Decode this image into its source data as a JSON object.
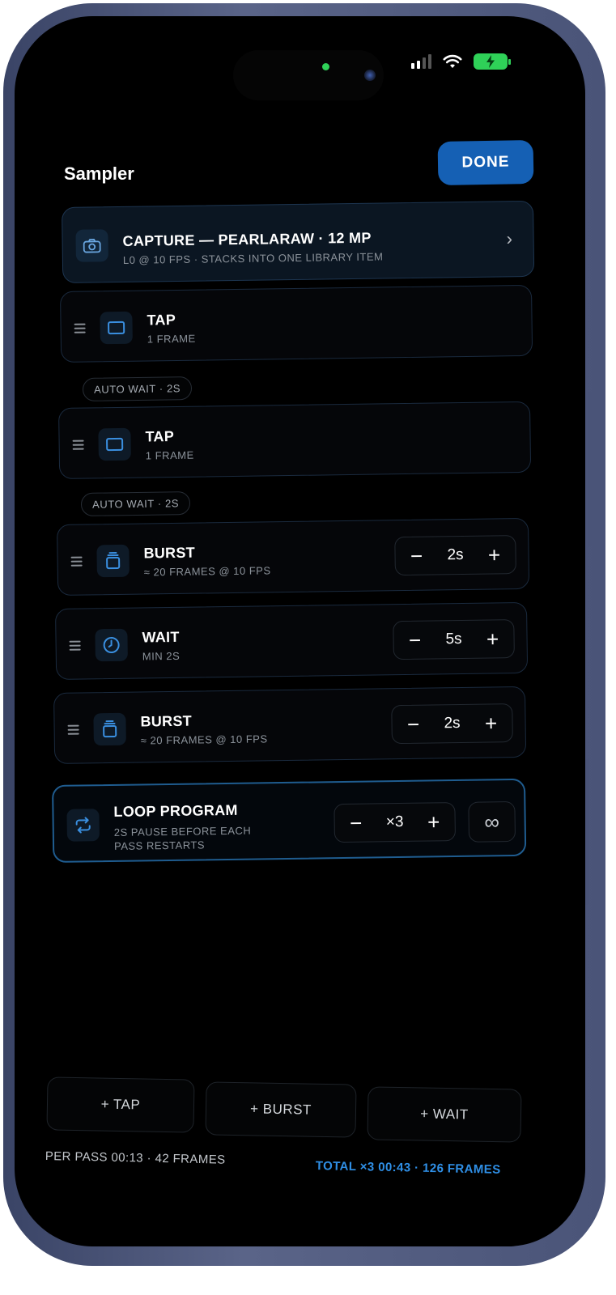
{
  "app": {
    "title": "Sampler",
    "done_label": "DONE"
  },
  "capture": {
    "title": "CAPTURE — PEARLARAW · 12 MP",
    "subtitle": "L0 @ 10 FPS · STACKS INTO ONE LIBRARY ITEM",
    "icon": "camera-icon",
    "chevron": "›"
  },
  "steps": [
    {
      "type": "tap",
      "title": "TAP",
      "subtitle": "1 FRAME",
      "icon": "frame-icon"
    },
    {
      "type": "tap",
      "title": "TAP",
      "subtitle": "1 FRAME",
      "icon": "frame-icon"
    },
    {
      "type": "burst",
      "title": "BURST",
      "subtitle": "≈ 20 FRAMES @ 10 FPS",
      "icon": "stack-icon",
      "value": "2s"
    },
    {
      "type": "wait",
      "title": "WAIT",
      "subtitle": "MIN 2S",
      "icon": "clock-icon",
      "value": "5s"
    },
    {
      "type": "burst",
      "title": "BURST",
      "subtitle": "≈ 20 FRAMES @ 10 FPS",
      "icon": "stack-icon",
      "value": "2s"
    }
  ],
  "auto_wait": [
    "AUTO WAIT · 2S",
    "AUTO WAIT · 2S"
  ],
  "stepper_glyphs": {
    "minus": "−",
    "plus": "+"
  },
  "loop": {
    "title": "LOOP PROGRAM",
    "subtitle_line1": "2S PAUSE BEFORE EACH",
    "subtitle_line2": "PASS RESTARTS",
    "icon": "repeat-icon",
    "value": "×3",
    "infinity": "∞"
  },
  "add_buttons": {
    "tap": "+ TAP",
    "burst": "+ BURST",
    "wait": "+ WAIT"
  },
  "summary": {
    "per_pass": "PER PASS  00:13 · 42 FRAMES",
    "total": "TOTAL ×3  00:43 · 126 FRAMES"
  },
  "colors": {
    "accent": "#1560b4",
    "accent_text": "#2f8fe6",
    "battery": "#2fd158"
  }
}
